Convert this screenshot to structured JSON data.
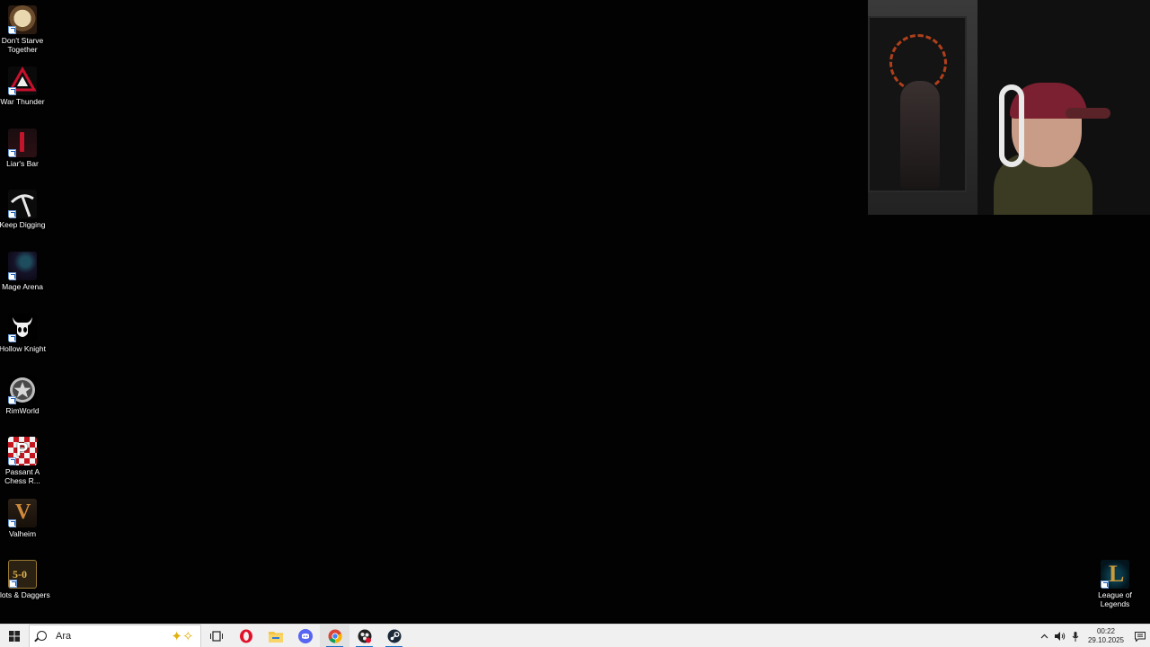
{
  "desktop": {
    "icons": [
      {
        "label": "Don't Starve Together",
        "icon": "dont-starve-together-icon"
      },
      {
        "label": "War Thunder",
        "icon": "war-thunder-icon"
      },
      {
        "label": "Liar's Bar",
        "icon": "liars-bar-icon"
      },
      {
        "label": "Keep Digging",
        "icon": "keep-digging-icon"
      },
      {
        "label": "Mage Arena",
        "icon": "mage-arena-icon"
      },
      {
        "label": "Hollow Knight",
        "icon": "hollow-knight-icon"
      },
      {
        "label": "RimWorld",
        "icon": "rimworld-icon"
      },
      {
        "label": "Passant A Chess R...",
        "icon": "passant-chess-icon"
      },
      {
        "label": "Valheim",
        "icon": "valheim-icon"
      },
      {
        "label": "Slots & Daggers",
        "icon": "slots-daggers-icon"
      },
      {
        "label": "League of Legends",
        "icon": "league-of-legends-icon"
      }
    ]
  },
  "taskbar": {
    "search_text": "Ara",
    "apps": [
      {
        "name": "task-view-icon"
      },
      {
        "name": "opera-icon"
      },
      {
        "name": "file-explorer-icon"
      },
      {
        "name": "discord-icon"
      },
      {
        "name": "chrome-icon"
      },
      {
        "name": "obs-icon"
      },
      {
        "name": "steam-icon"
      }
    ],
    "clock": {
      "time": "00:22",
      "date": "29.10.2025"
    },
    "colors": {
      "accent": "#1b72c9",
      "taskbar_bg": "#f0f0f0"
    }
  }
}
